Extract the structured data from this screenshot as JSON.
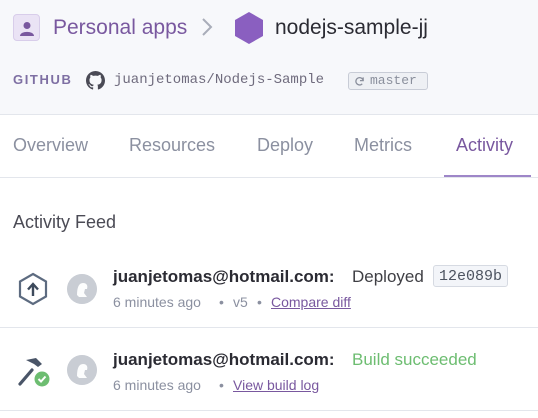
{
  "breadcrumb": {
    "apps_label": "Personal apps",
    "app_name": "nodejs-sample-jj"
  },
  "source": {
    "provider_label": "GITHUB",
    "repo": "juanjetomas/Nodejs-Sample",
    "branch": "master"
  },
  "tabs": [
    {
      "label": "Overview"
    },
    {
      "label": "Resources"
    },
    {
      "label": "Deploy"
    },
    {
      "label": "Metrics"
    },
    {
      "label": "Activity",
      "active": true
    }
  ],
  "feed": {
    "title": "Activity Feed",
    "items": [
      {
        "icon": "deploy-icon",
        "actor": "juanjetomas@hotmail.com:",
        "action": "Deployed",
        "commit": "12e089b",
        "time": "6 minutes ago",
        "release": "v5",
        "link": "Compare diff"
      },
      {
        "icon": "build-success-icon",
        "actor": "juanjetomas@hotmail.com:",
        "action": "Build succeeded",
        "time": "6 minutes ago",
        "link": "View build log"
      }
    ]
  },
  "colors": {
    "accent": "#79589f",
    "success": "#6dbd71",
    "header_bg": "#f7f8fb",
    "hex_purple": "#8a5fc0"
  }
}
